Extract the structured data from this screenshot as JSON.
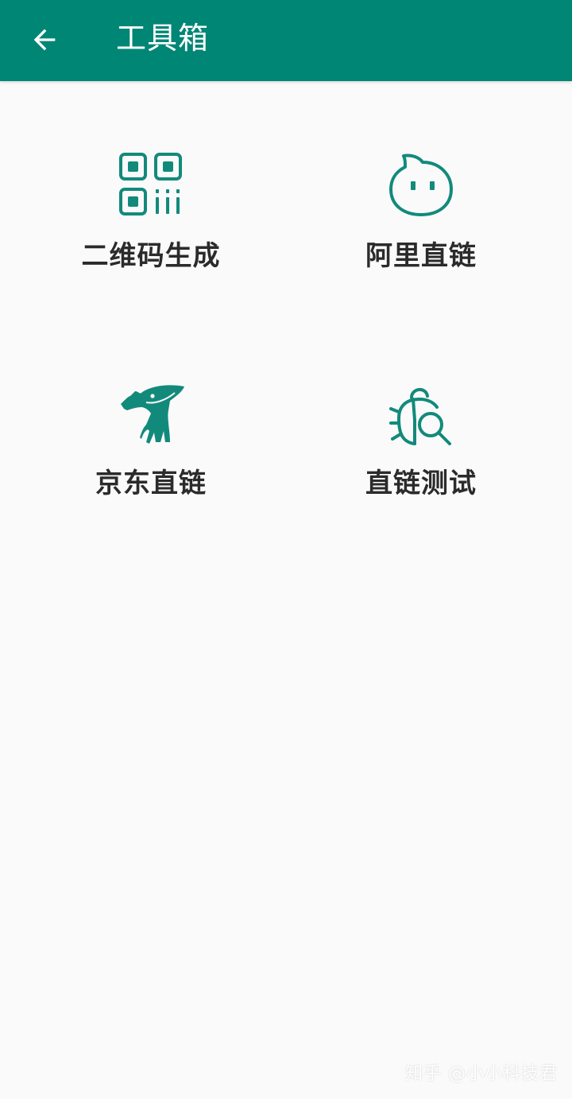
{
  "colors": {
    "appbar": "#008675",
    "accent": "#128a7b",
    "background": "#fafafa",
    "label": "#2b2b2b"
  },
  "appbar": {
    "back_icon": "arrow-left-icon",
    "title": "工具箱"
  },
  "tools": [
    {
      "label": "二维码生成",
      "icon": "qr-code-icon"
    },
    {
      "label": "阿里直链",
      "icon": "aliyun-drive-icon"
    },
    {
      "label": "京东直链",
      "icon": "jd-joy-dog-icon"
    },
    {
      "label": "直链测试",
      "icon": "bug-search-icon"
    }
  ],
  "watermark": "知乎 @小小科技君"
}
